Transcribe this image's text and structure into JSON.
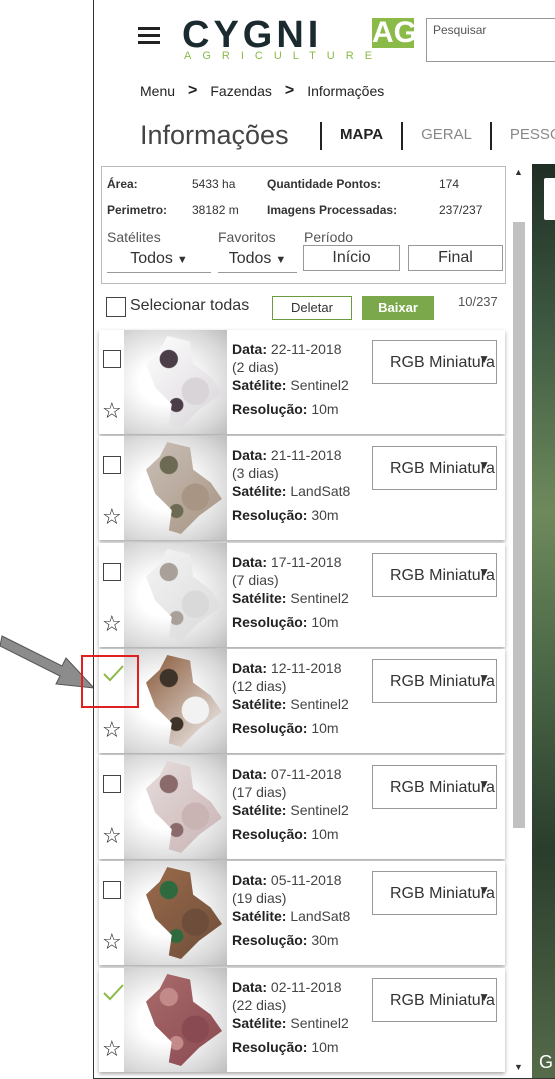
{
  "header": {
    "logo_main": "CYGNI",
    "logo_ag": "AG",
    "logo_sub": "AGRICULTURE",
    "search_placeholder": "Pesquisar"
  },
  "breadcrumb": [
    "Menu",
    "Fazendas",
    "Informações"
  ],
  "page_title": "Informações",
  "tabs": [
    {
      "label": "MAPA",
      "active": true
    },
    {
      "label": "GERAL",
      "active": false
    },
    {
      "label": "PESSOA",
      "active": false
    }
  ],
  "info": {
    "area_label": "Área:",
    "area_value": "5433 ha",
    "perimeter_label": "Perimetro:",
    "perimeter_value": "38182 m",
    "points_label": "Quantidade Pontos:",
    "points_value": "174",
    "images_label": "Imagens Processadas:",
    "images_value": "237/237"
  },
  "filters": {
    "satellites_label": "Satélites",
    "satellites_value": "Todos",
    "favorites_label": "Favoritos",
    "favorites_value": "Todos",
    "period_label": "Período",
    "start_label": "Início",
    "end_label": "Final"
  },
  "select_bar": {
    "select_all": "Selecionar todas",
    "delete": "Deletar",
    "download": "Baixar",
    "count": "10/237"
  },
  "labels": {
    "date": "Data:",
    "satellite": "Satélite:",
    "resolution": "Resolução:"
  },
  "images": [
    {
      "date": "22-11-2018",
      "ago": "(2 dias)",
      "satellite": "Sentinel2",
      "resolution": "10m",
      "band": "RGB Miniatura",
      "selected": false,
      "palette": [
        "#ffffff",
        "#d8d4d8",
        "#4b3e48"
      ]
    },
    {
      "date": "21-11-2018",
      "ago": "(3 dias)",
      "satellite": "LandSat8",
      "resolution": "30m",
      "band": "RGB Miniatura",
      "selected": false,
      "palette": [
        "#c9bfb6",
        "#a89584",
        "#6c6a52"
      ]
    },
    {
      "date": "17-11-2018",
      "ago": "(7 dias)",
      "satellite": "Sentinel2",
      "resolution": "10m",
      "band": "RGB Miniatura",
      "selected": false,
      "palette": [
        "#f4f4f4",
        "#d9d9d9",
        "#a9a09a"
      ]
    },
    {
      "date": "12-11-2018",
      "ago": "(12 dias)",
      "satellite": "Sentinel2",
      "resolution": "10m",
      "band": "RGB Miniatura",
      "selected": true,
      "palette": [
        "#8a5a3a",
        "#f2f2f2",
        "#3e3328"
      ]
    },
    {
      "date": "07-11-2018",
      "ago": "(17 dias)",
      "satellite": "Sentinel2",
      "resolution": "10m",
      "band": "RGB Miniatura",
      "selected": false,
      "palette": [
        "#e6dcdc",
        "#c9b3b3",
        "#8a6a6a"
      ]
    },
    {
      "date": "05-11-2018",
      "ago": "(19 dias)",
      "satellite": "LandSat8",
      "resolution": "30m",
      "band": "RGB Miniatura",
      "selected": false,
      "palette": [
        "#9a6a4a",
        "#6e4e3a",
        "#2f6a3f"
      ]
    },
    {
      "date": "02-11-2018",
      "ago": "(22 dias)",
      "satellite": "Sentinel2",
      "resolution": "10m",
      "band": "RGB Miniatura",
      "selected": true,
      "palette": [
        "#a86a6a",
        "#8a4a52",
        "#c38a8a"
      ]
    }
  ],
  "map": {
    "corner_glyph": "G"
  },
  "colors": {
    "brand_green": "#8aba47",
    "button_green": "#7aa84a",
    "annotation_red": "#e02020"
  }
}
